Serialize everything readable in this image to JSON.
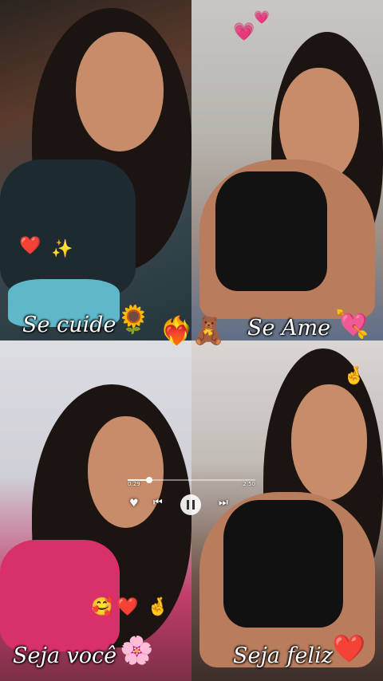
{
  "panels": [
    {
      "caption": "Se cuide",
      "emojis": [
        "❤️",
        "✨",
        "🌻"
      ]
    },
    {
      "caption": "Se Ame",
      "emojis": [
        "💗",
        "💘",
        "💗"
      ]
    },
    {
      "caption": "Seja você",
      "emojis": [
        "🥰",
        "❤️",
        "🤞",
        "🌸"
      ]
    },
    {
      "caption": "Seja feliz",
      "emojis": [
        "🤞",
        "❤️"
      ]
    }
  ],
  "center_emojis": [
    "❤️‍🔥",
    "🧸"
  ],
  "player": {
    "elapsed": "0:29",
    "total": "2:50",
    "progress": 0.17,
    "icons": [
      "heart-icon",
      "previous-icon",
      "pause-icon",
      "next-icon"
    ]
  },
  "colors": {
    "caption_text": "#ffffff",
    "heart": "#e0102a"
  }
}
